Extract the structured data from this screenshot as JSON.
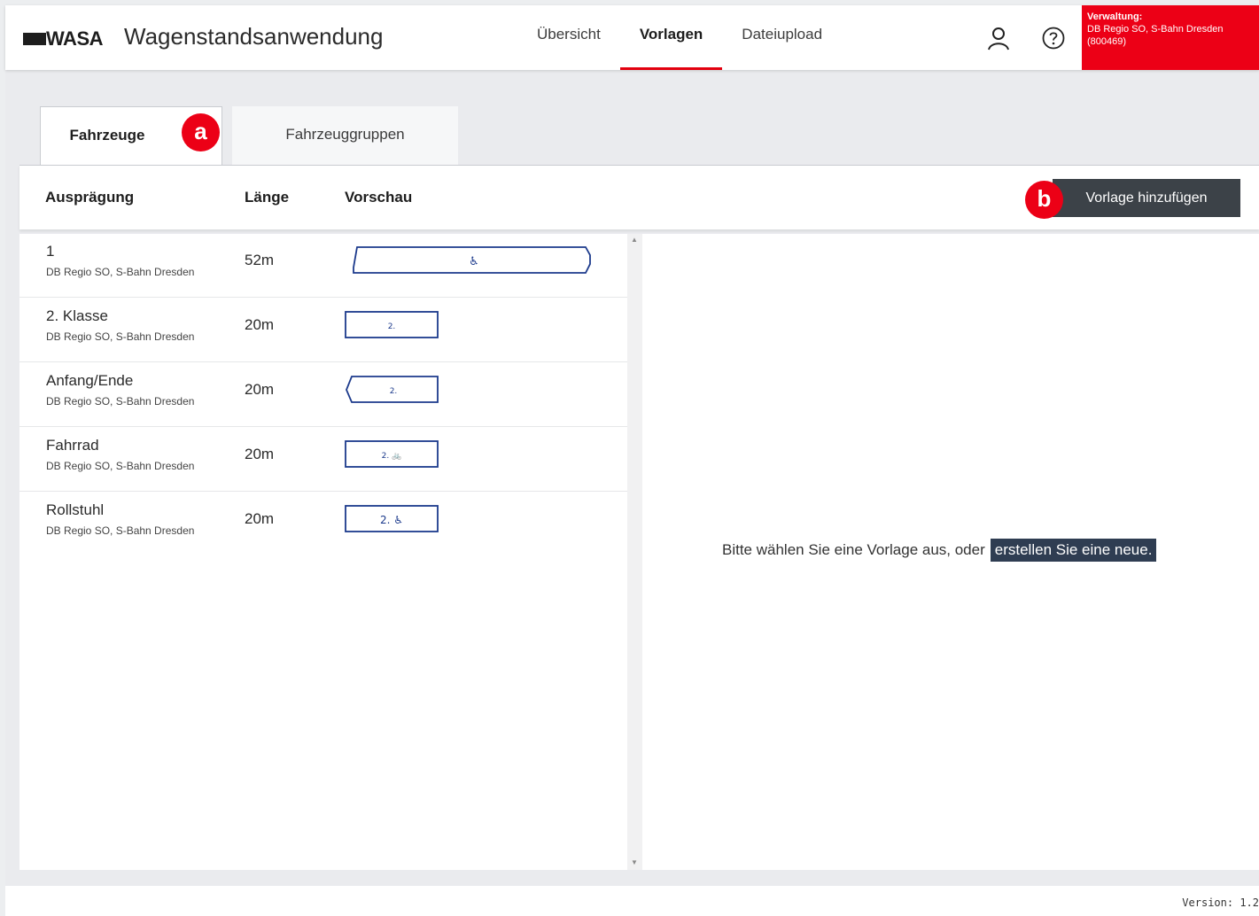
{
  "header": {
    "logo": "WASA",
    "title": "Wagenstandsanwendung",
    "nav": [
      "Übersicht",
      "Vorlagen",
      "Dateiupload"
    ],
    "active_nav": "Vorlagen",
    "icons": [
      "user-icon",
      "help-icon"
    ],
    "admin": {
      "label": "Verwaltung:",
      "org": "DB Regio SO, S-Bahn Dresden",
      "id": "(800469)"
    }
  },
  "tabs": {
    "vehicles": "Fahrzeuge",
    "groups": "Fahrzeuggruppen"
  },
  "badges": {
    "a": "a",
    "b": "b"
  },
  "table": {
    "columns": [
      "Ausprägung",
      "Länge",
      "Vorschau"
    ],
    "add_button": "Vorlage hinzufügen",
    "rows": [
      {
        "name": "1",
        "owner": "DB Regio SO, S-Bahn Dresden",
        "length": "52m",
        "preview_label": "♿"
      },
      {
        "name": "2. Klasse",
        "owner": "DB Regio SO, S-Bahn Dresden",
        "length": "20m",
        "preview_label": "2."
      },
      {
        "name": "Anfang/Ende",
        "owner": "DB Regio SO, S-Bahn Dresden",
        "length": "20m",
        "preview_label": "2."
      },
      {
        "name": "Fahrrad",
        "owner": "DB Regio SO, S-Bahn Dresden",
        "length": "20m",
        "preview_label": "2. 🚲"
      },
      {
        "name": "Rollstuhl",
        "owner": "DB Regio SO, S-Bahn Dresden",
        "length": "20m",
        "preview_label": "2. ♿"
      }
    ]
  },
  "detail": {
    "hint": "Bitte wählen Sie eine Vorlage aus, oder",
    "link": "erstellen Sie eine neue."
  },
  "footer": {
    "version": "Version: 1.2"
  },
  "colors": {
    "accent": "#ec0016",
    "dark_button": "#3c4248",
    "link_bg": "#2f3d52",
    "preview_stroke": "#1c3a8c"
  }
}
